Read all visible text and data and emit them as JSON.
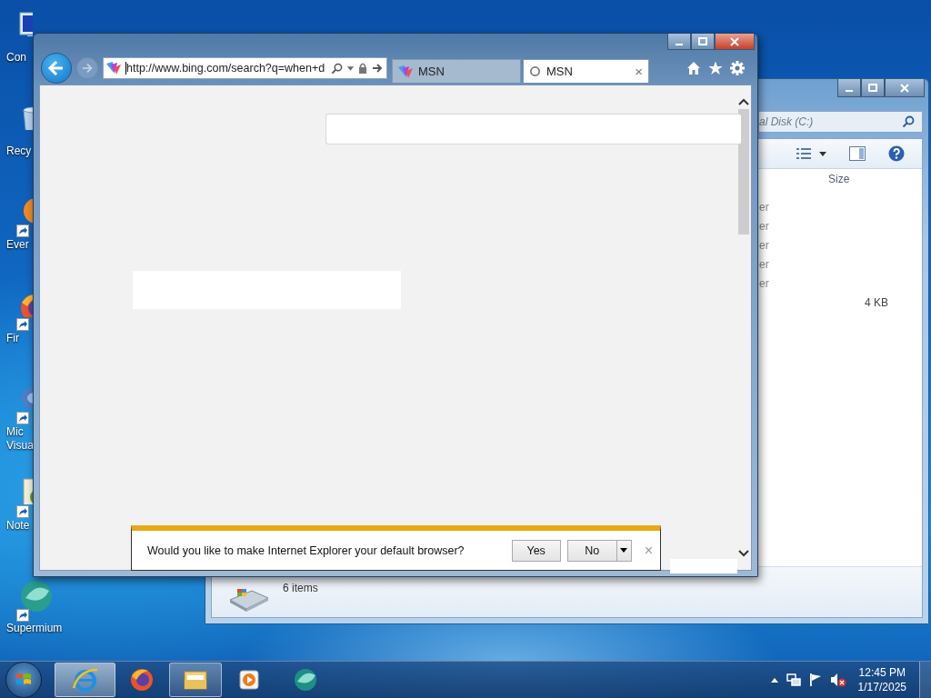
{
  "desktop_icons": [
    {
      "kind": "computer",
      "lines": [
        "Con"
      ],
      "shortcut": false
    },
    {
      "kind": "recycle",
      "lines": [
        "Recy"
      ],
      "shortcut": false
    },
    {
      "kind": "notes",
      "lines": [
        "Ever"
      ],
      "shortcut": true
    },
    {
      "kind": "firefox",
      "lines": [
        "Fir"
      ],
      "shortcut": true
    },
    {
      "kind": "studio",
      "lines": [
        "Mic",
        "Visua"
      ],
      "shortcut": true
    },
    {
      "kind": "notepad",
      "lines": [
        "Note"
      ],
      "shortcut": true
    },
    {
      "kind": "supermium",
      "lines": [
        "Supermium"
      ],
      "shortcut": true
    }
  ],
  "explorer": {
    "address": "al Disk (C:)",
    "column_heading": "Size",
    "rows": [
      {
        "name": "er"
      },
      {
        "name": "er"
      },
      {
        "name": "er"
      },
      {
        "name": "er"
      },
      {
        "name": "er"
      },
      {
        "size": "4 KB"
      }
    ],
    "status": "6 items"
  },
  "browser": {
    "address": "http://www.bing.com/search?q=when+d",
    "tabs": [
      {
        "label": "MSN",
        "selected": false,
        "kind": "site"
      },
      {
        "label": "MSN",
        "selected": true,
        "kind": "loading",
        "close": "×"
      }
    ],
    "notification": {
      "message": "Would you like to make Internet Explorer your default browser?",
      "buttons": [
        "Yes",
        "No"
      ],
      "close": "×"
    }
  },
  "taskbar": {
    "items": [
      {
        "kind": "ie",
        "open": true,
        "selected": true
      },
      {
        "kind": "firefox",
        "open": false,
        "selected": false
      },
      {
        "kind": "explorer",
        "open": true,
        "selected": false
      },
      {
        "kind": "media",
        "open": false,
        "selected": false
      },
      {
        "kind": "supermium",
        "open": false,
        "selected": false
      }
    ],
    "time": "12:45 PM",
    "date": "1/17/2025"
  }
}
